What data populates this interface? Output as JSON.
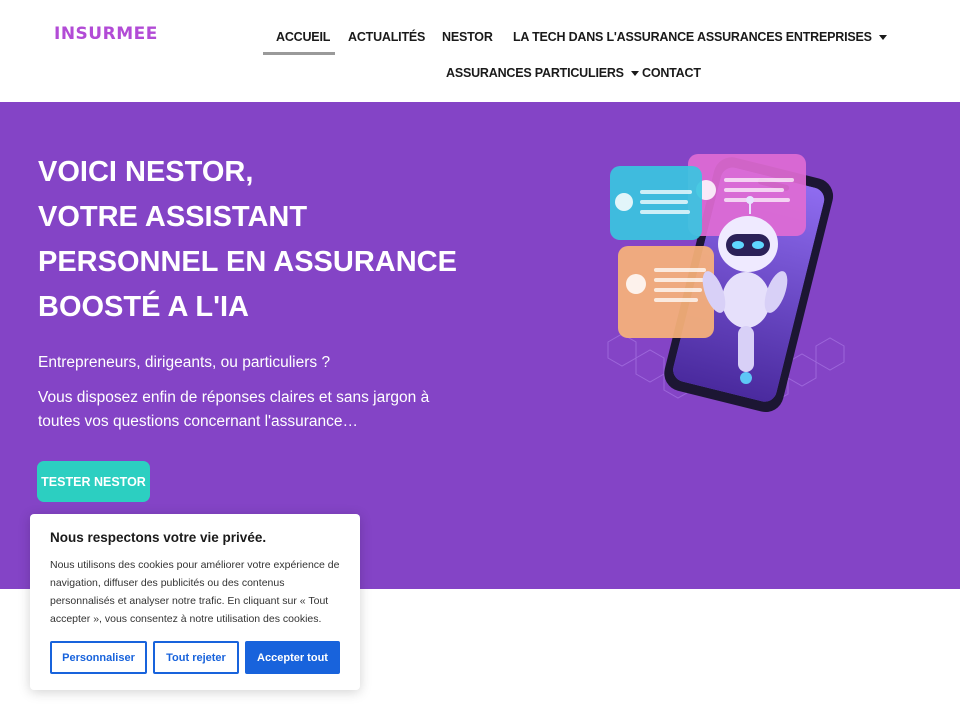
{
  "header": {
    "logo": "INSURMEE",
    "nav": [
      {
        "label": "ACCUEIL"
      },
      {
        "label": "ACTUALITÉS"
      },
      {
        "label": "NESTOR"
      },
      {
        "label": "LA TECH DANS L'ASSURANCE"
      },
      {
        "label": "ASSURANCES ENTREPRISES"
      },
      {
        "label": "ASSURANCES PARTICULIERS"
      },
      {
        "label": "CONTACT"
      }
    ]
  },
  "hero": {
    "title_lines": [
      "VOICI NESTOR,",
      "VOTRE ASSISTANT",
      "PERSONNEL EN ASSURANCE",
      "BOOSTÉ A L'IA"
    ],
    "subtitle1": "Entrepreneurs, dirigeants, ou particuliers ?",
    "subtitle2": "Vous disposez enfin de réponses claires et sans jargon à toutes vos questions concernant l'assurance…",
    "cta": "TESTER NESTOR",
    "illustration": "robot-phone-chat-illustration"
  },
  "cookie": {
    "title": "Nous respectons votre vie privée.",
    "text": "Nous utilisons des cookies pour améliorer votre expérience de navigation, diffuser des publicités ou des contenus personnalisés et analyser notre trafic. En cliquant sur « Tout accepter », vous consentez à notre utilisation des cookies.",
    "customize": "Personnaliser",
    "reject": "Tout rejeter",
    "accept": "Accepter tout"
  },
  "colors": {
    "brand_purple": "#8444c6",
    "logo_purple": "#b24bd6",
    "cta_teal": "#2ccfc1",
    "cookie_blue": "#1863dc"
  }
}
